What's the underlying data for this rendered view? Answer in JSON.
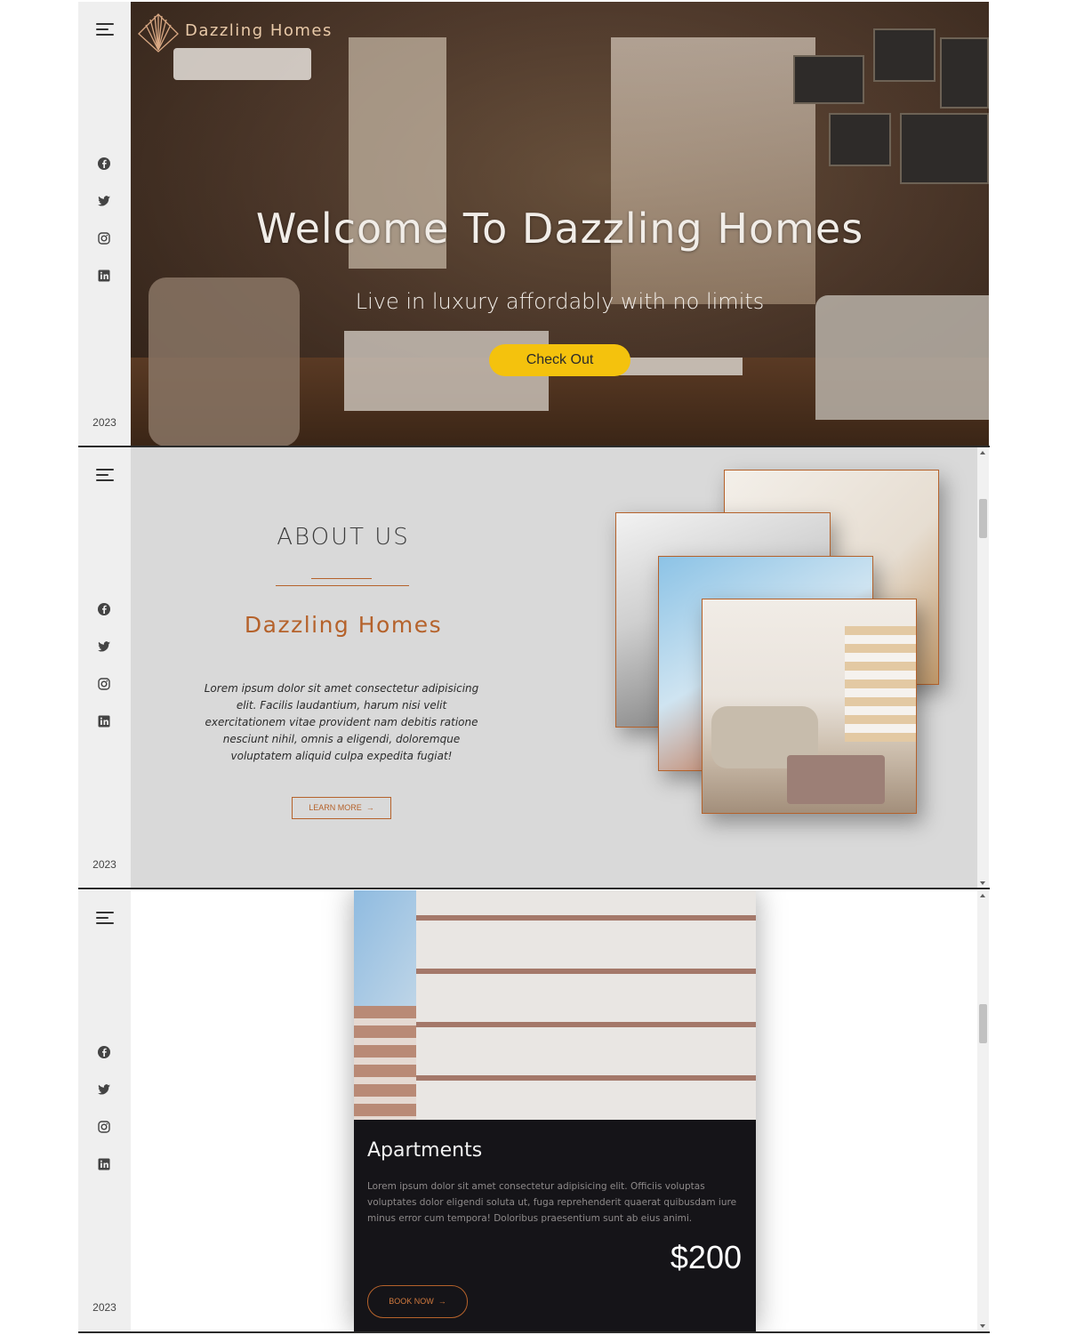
{
  "common": {
    "year": "2023",
    "icons": [
      "menu-icon",
      "facebook-icon",
      "twitter-icon",
      "instagram-icon",
      "linkedin-icon"
    ]
  },
  "hero": {
    "logo_text": "Dazzling Homes",
    "title": "Welcome To Dazzling Homes",
    "subtitle": "Live in luxury affordably with no limits",
    "cta_label": "Check Out"
  },
  "about": {
    "title": "ABOUT US",
    "brand": "Dazzling Homes",
    "text": "Lorem ipsum dolor sit amet consectetur adipisicing elit. Facilis laudantium, harum nisi velit exercitationem vitae provident nam debitis ratione nesciunt nihil, omnis a eligendi, doloremque voluptatem aliquid culpa expedita fugiat!",
    "button_label": "LEARN MORE",
    "button_icon": "arrow-right-icon"
  },
  "apartment": {
    "title": "Apartments",
    "text": "Lorem ipsum dolor sit amet consectetur adipisicing elit. Officiis voluptas voluptates dolor eligendi soluta ut, fuga reprehenderit quaerat quibusdam iure minus error cum tempora! Doloribus praesentium sunt ab eius animi.",
    "price": "$200",
    "button_label": "BOOK NOW",
    "button_icon": "arrow-right-icon"
  },
  "colors": {
    "accent": "#b5622b",
    "cta": "#f4c20d",
    "sidebar": "#efefef",
    "card_bg": "#151418"
  }
}
